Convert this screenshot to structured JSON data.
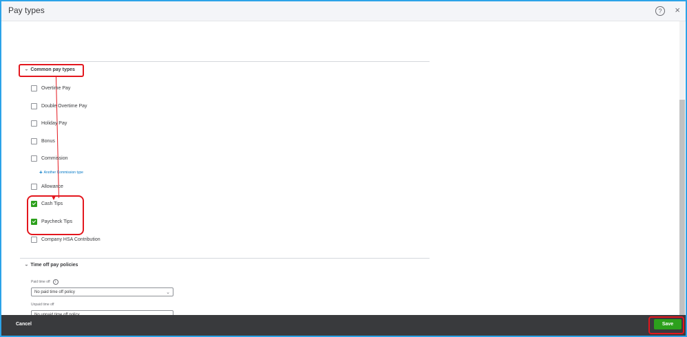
{
  "dialog": {
    "title": "Pay types",
    "help_glyph": "?",
    "close_glyph": "×"
  },
  "common_pay_types": {
    "heading": "Common pay types",
    "items": [
      {
        "label": "Overtime Pay",
        "checked": false
      },
      {
        "label": "Double Overtime Pay",
        "checked": false
      },
      {
        "label": "Holiday Pay",
        "checked": false
      },
      {
        "label": "Bonus",
        "checked": false
      },
      {
        "label": "Commission",
        "checked": false
      },
      {
        "label": "Allowance",
        "checked": false
      },
      {
        "label": "Cash Tips",
        "checked": true
      },
      {
        "label": "Paycheck Tips",
        "checked": true
      },
      {
        "label": "Company HSA Contribution",
        "checked": false
      }
    ],
    "commission_link": "Another Commission type",
    "link_glyph": "+"
  },
  "time_off": {
    "heading": "Time off pay policies",
    "paid_label": "Paid time off",
    "paid_value": "No paid time off policy",
    "unpaid_label": "Unpaid time off",
    "unpaid_value": "No unpaid time off policy",
    "info_glyph": "i"
  },
  "footer": {
    "cancel": "Cancel",
    "save": "Save"
  },
  "colors": {
    "accent_green": "#2ca01c",
    "annotation_red": "#e3161d",
    "frame_blue": "#2ca3e8",
    "footer_bg": "#393a3d"
  },
  "icons": {
    "chevron": "›",
    "caret": "⌄"
  }
}
